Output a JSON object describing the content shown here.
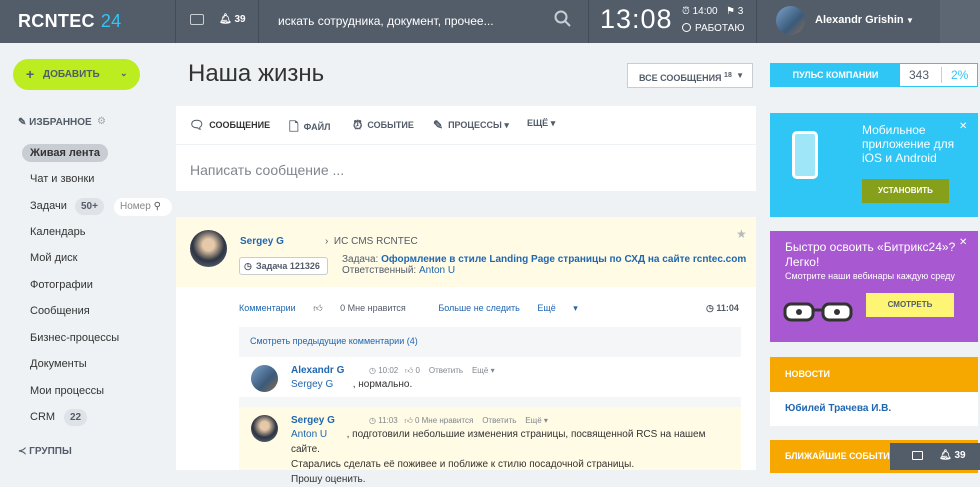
{
  "header": {
    "logo_text": "RCNTEC",
    "logo_num": "24",
    "notifications_count": "39",
    "search_placeholder": "искать сотрудника, документ, прочее...",
    "clock": "13:08",
    "alarm_time": "14:00",
    "tasks_count": "3",
    "work_status": "РАБОТАЮ",
    "user_name": "Alexandr Grishin"
  },
  "left_menu": {
    "add_button": "ДОБАВИТЬ",
    "favorites_title": "ИЗБРАННОЕ",
    "items": [
      {
        "label": "Живая лента"
      },
      {
        "label": "Чат и звонки"
      },
      {
        "label": "Задачи",
        "count": "50+"
      },
      {
        "label": "Календарь"
      },
      {
        "label": "Мой диск"
      },
      {
        "label": "Фотографии"
      },
      {
        "label": "Сообщения"
      },
      {
        "label": "Бизнес-процессы"
      },
      {
        "label": "Документы"
      },
      {
        "label": "Мои процессы"
      },
      {
        "label": "CRM",
        "count": "22"
      }
    ],
    "nomer_placeholder": "Номер",
    "groups_title": "ГРУППЫ"
  },
  "main": {
    "title": "Наша жизнь",
    "filter_label": "ВСЕ СООБЩЕНИЯ",
    "filter_count": "18",
    "composer_tabs": [
      "СООБЩЕНИЕ",
      "ФАЙЛ",
      "СОБЫТИЕ",
      "ПРОЦЕССЫ",
      "ЕЩЁ"
    ],
    "composer_placeholder": "Написать сообщение ...",
    "post": {
      "author": "Sergey G",
      "destination": "ИС CMS RCNTEC",
      "task_badge": "Задача 121326",
      "task_prefix": "Задача:",
      "task_title": "Оформление в стиле Landing Page страницы по СХД на сайте rcntec.com",
      "responsible_prefix": "Ответственный:",
      "responsible": "Anton U",
      "actions": [
        "Комментарии",
        "0 Мне нравится",
        "Больше не следить",
        "Ещё"
      ],
      "time": "11:04",
      "prev_comments": "Смотреть предыдущие комментарии (4)",
      "comments": [
        {
          "author": "Alexandr G",
          "time": "10:02",
          "likes": "0",
          "reply": "Ответить",
          "more": "Ещё",
          "mention": "Sergey G",
          "text": ", нормально."
        },
        {
          "author": "Sergey G",
          "time": "11:03",
          "likes": "0 Мне нравится",
          "reply": "Ответить",
          "more": "Ещё",
          "mention": "Anton U",
          "text": ", подготовили небольшие изменения страницы, посвященной RCS на нашем сайте.",
          "text2": "Старались сделать её поживее и поближе к стилю посадочной страницы.",
          "text3": "Прошу оценить."
        }
      ]
    }
  },
  "right": {
    "pulse_label": "ПУЛЬС КОМПАНИИ",
    "pulse_value": "343",
    "pulse_percent": "2%",
    "banner1_title": "Мобильное приложение для iOS и Android",
    "banner1_button": "УСТАНОВИТЬ",
    "banner2_title": "Быстро освоить «Битрикс24»? Легко!",
    "banner2_sub": "Смотрите наши вебинары каждую среду",
    "banner2_button": "СМОТРЕТЬ",
    "news_title": "НОВОСТИ",
    "news_item": "Юбилей Трачева И.В.",
    "events_title": "БЛИЖАЙШИЕ СОБЫТИЯ"
  },
  "bottom_bar": {
    "notifications": "39"
  },
  "colors": {
    "header_bg": "#535c69",
    "accent_blue": "#2fc6f6",
    "add_green": "#bbed21",
    "link_blue": "#2067b0",
    "orange": "#f6a800",
    "purple": "#a859d2"
  }
}
